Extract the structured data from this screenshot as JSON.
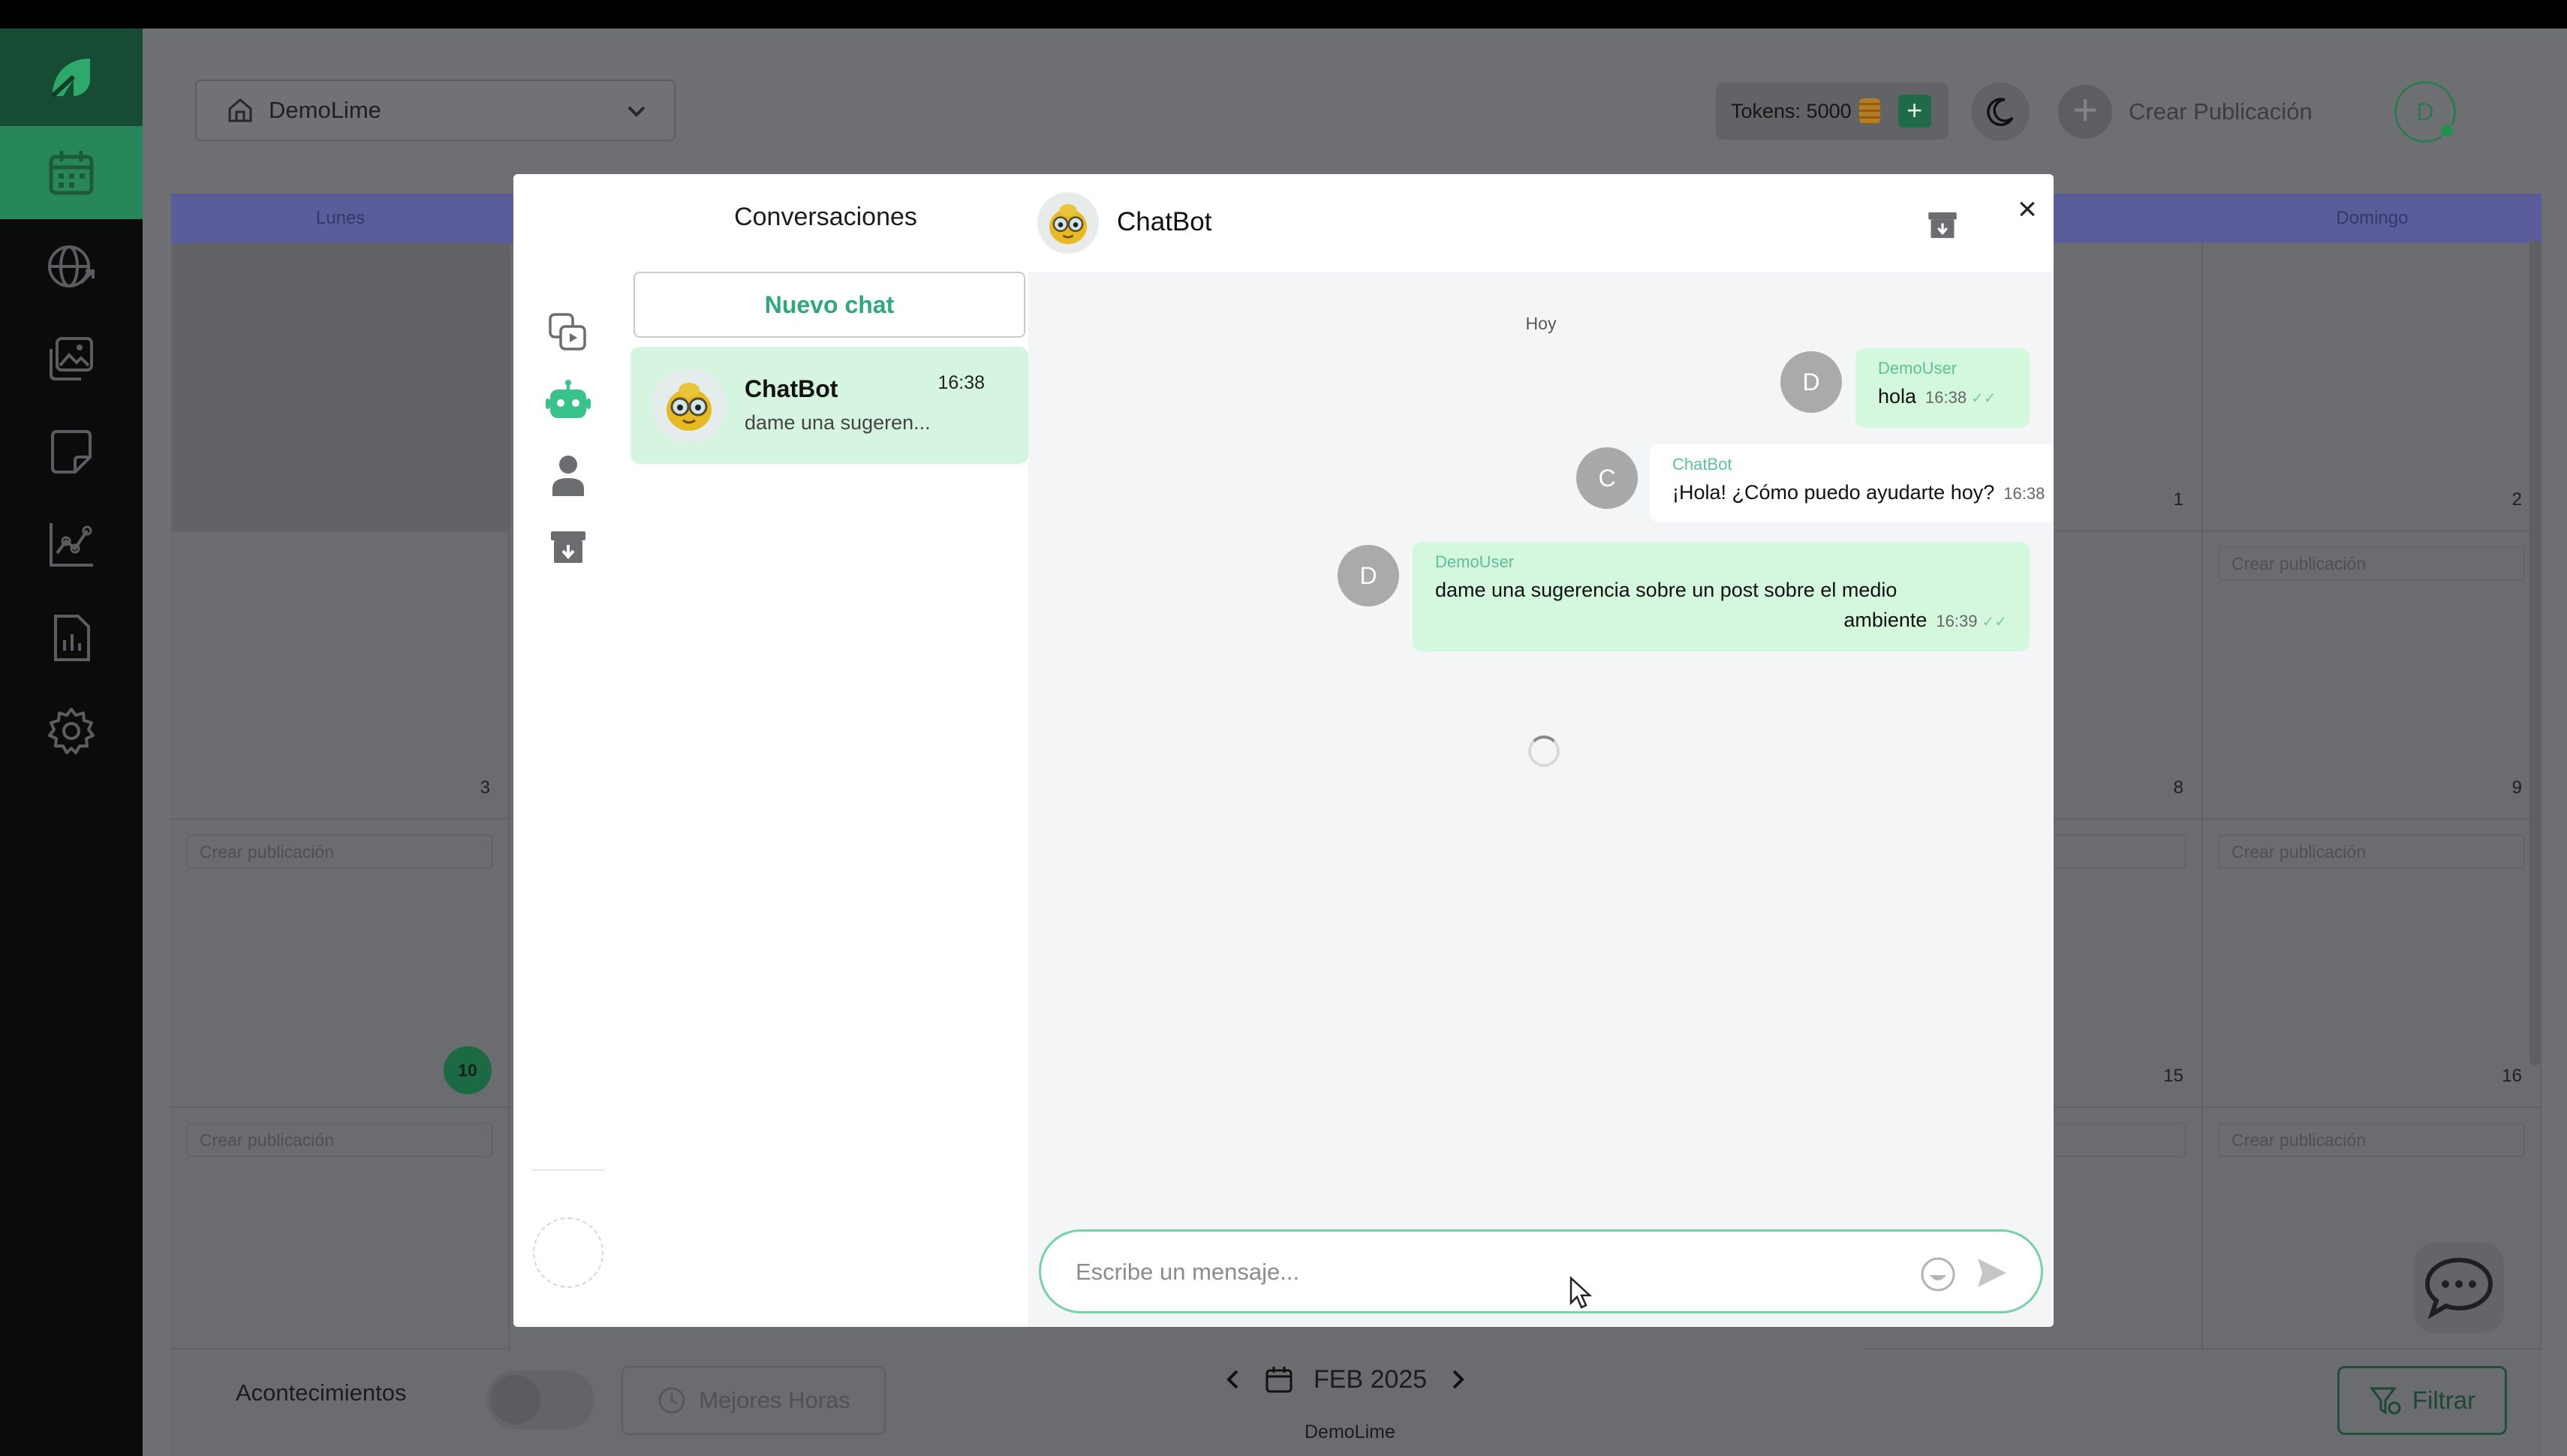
{
  "topbar": {
    "workspace": "DemoLime",
    "tokens_label": "Tokens: 5000",
    "create_post": "Crear Publicación",
    "avatar_initial": "D"
  },
  "calendar": {
    "weekdays": [
      "Lunes",
      "",
      "",
      "",
      "",
      "",
      "Domingo"
    ],
    "dates": {
      "sat_w1": "1",
      "sun_w1": "2",
      "mon_w2": "3",
      "sat_w2": "8",
      "sun_w2": "9",
      "mon_w3": "10",
      "sat_w3": "15",
      "sun_w3": "16"
    },
    "create_placeholder": "Crear publicación"
  },
  "bottombar": {
    "events_label": "Acontecimientos",
    "best_hours": "Mejores Horas",
    "month": "FEB 2025",
    "workspace": "DemoLime",
    "filter": "Filtrar"
  },
  "conversations": {
    "title": "Conversaciones",
    "new_chat": "Nuevo chat",
    "items": [
      {
        "name": "ChatBot",
        "time": "16:38",
        "preview": "dame una sugeren..."
      }
    ]
  },
  "chat": {
    "title": "ChatBot",
    "day_label": "Hoy",
    "messages": [
      {
        "from": "user",
        "sender": "DemoUser",
        "initial": "D",
        "text": "hola",
        "time": "16:38"
      },
      {
        "from": "bot",
        "sender": "ChatBot",
        "initial": "C",
        "text": "¡Hola! ¿Cómo puedo ayudarte hoy?",
        "time": "16:38"
      },
      {
        "from": "user",
        "sender": "DemoUser",
        "initial": "D",
        "text_line1": "dame una sugerencia sobre un post sobre el medio",
        "text_line2": "ambiente",
        "time": "16:39"
      }
    ],
    "input_placeholder": "Escribe un mensaje...",
    "check_glyph": "✓✓"
  },
  "colors": {
    "brand": "#28875a",
    "accent": "#2fa87a",
    "user_bubble": "#d3f8dd",
    "conv_active": "#d6f5e1"
  },
  "icons": [
    "logo-icon",
    "calendar-icon",
    "globe-icon",
    "gallery-icon",
    "note-icon",
    "analytics-icon",
    "report-icon",
    "settings-icon",
    "home-icon",
    "chevron-down-icon",
    "coin-icon",
    "plus-icon",
    "moon-icon",
    "archive-icon",
    "close-icon",
    "emoji-icon",
    "send-icon",
    "chat-bubble-icon",
    "filter-icon",
    "clock-icon",
    "chevron-left-icon",
    "chevron-right-icon",
    "robot-icon",
    "user-icon",
    "media-icon"
  ]
}
